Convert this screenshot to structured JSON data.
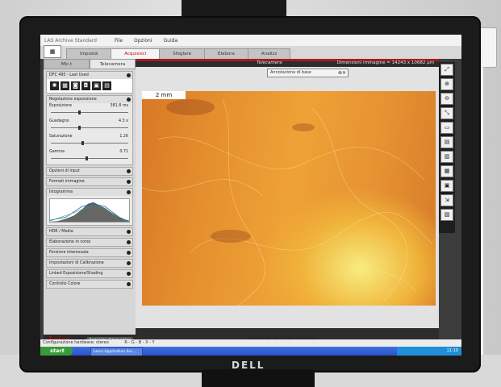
{
  "window": {
    "app_title": "LAS Archive Standard",
    "menu": [
      "File",
      "Opzioni",
      "Guida"
    ]
  },
  "tabs": [
    "Impostà",
    "Acquisisci",
    "Sfoglare",
    "Elabora",
    "Analizz"
  ],
  "active_tab": "Acquisisci",
  "left_panel": {
    "subtabs": [
      "Mic.t",
      "Telecamera"
    ],
    "camera_select": "DFC 495 - Last Used",
    "sections": {
      "exposure": "Regolazione esposizione",
      "input": "Opzioni di input",
      "format": "Formati immagine",
      "histogram": "Istogramma",
      "hdr": "HDR / Media",
      "stitch": "Elaborazione in corso",
      "roi": "Porzione interessata",
      "calib": "Impostazioni di Calibrazione",
      "shading": "Linked Esposizione/Shading",
      "color": "Controllo Colore"
    },
    "sliders": [
      {
        "label": "Esposizione",
        "value": "381.8 ms",
        "level": 0.35
      },
      {
        "label": "Guadagno",
        "value": "4.3 x",
        "level": 0.35
      },
      {
        "label": "Saturazione",
        "value": "1.26",
        "level": 0.4
      },
      {
        "label": "Gamma",
        "value": "0.71",
        "level": 0.45
      }
    ]
  },
  "acquire": {
    "brand": "Leica",
    "button": "Acquisire l'immagine"
  },
  "viewer": {
    "title": "Telecamera",
    "dimensions": "Dimensioni immagine = 14243 x 10682 µm",
    "annotation": "Annotazione di base",
    "scale": "2 mm",
    "coords": "Tavolino X: - Y: - Z: 187.1545 mm"
  },
  "status": {
    "text": "Configurazione hardware: stereo",
    "rgb": "R - G - B - X - Y"
  },
  "taskbar": {
    "start": "start",
    "task": "Leica Application Sui...",
    "clock": "11:10"
  },
  "monitor_brand": "DELL"
}
